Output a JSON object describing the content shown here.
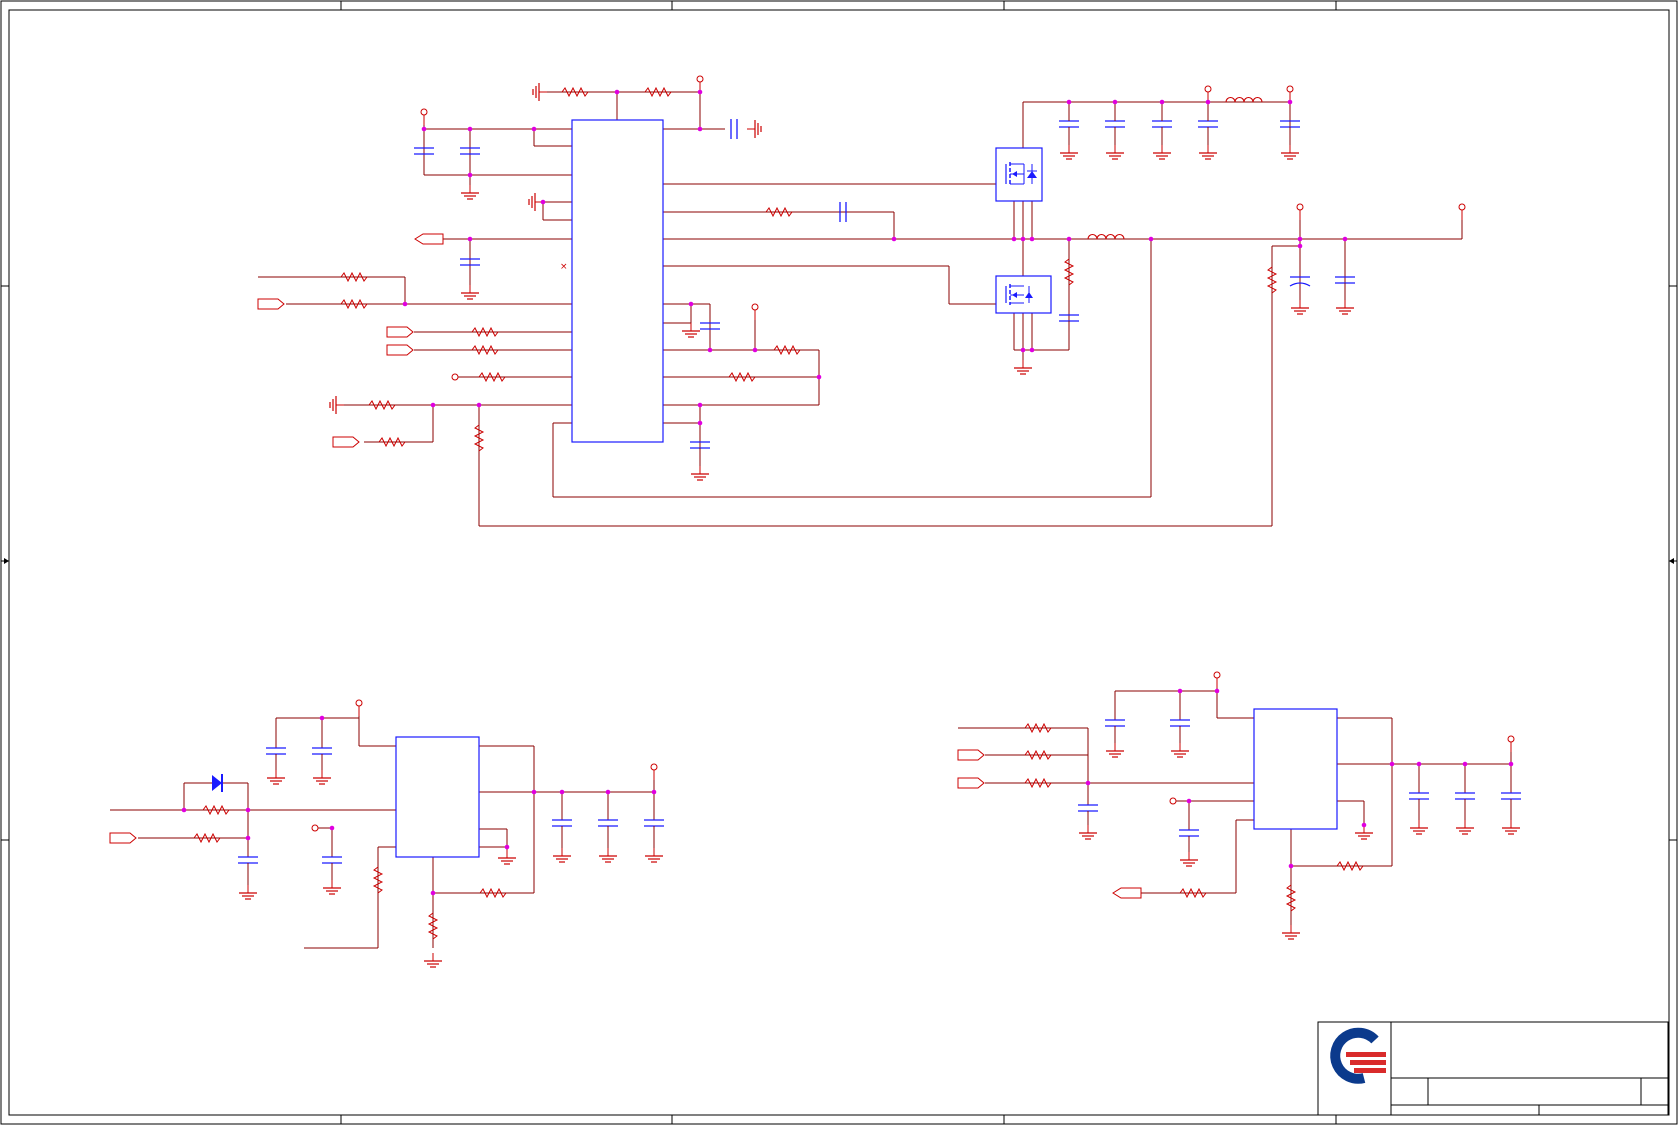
{
  "sheet": {
    "border_color": "#000000",
    "title_block_lines": "#000000"
  },
  "colors": {
    "wire": "#8b0000",
    "symbol": "#cc0000",
    "body": "#1a1aff",
    "junction": "#e000e0",
    "logo_blue": "#0b3a8c",
    "logo_red": "#d92b2b"
  },
  "icons": {
    "logo": "company-logo",
    "ground": "ground-icon",
    "power": "power-port-icon",
    "offpage": "offpage-connector-icon"
  }
}
